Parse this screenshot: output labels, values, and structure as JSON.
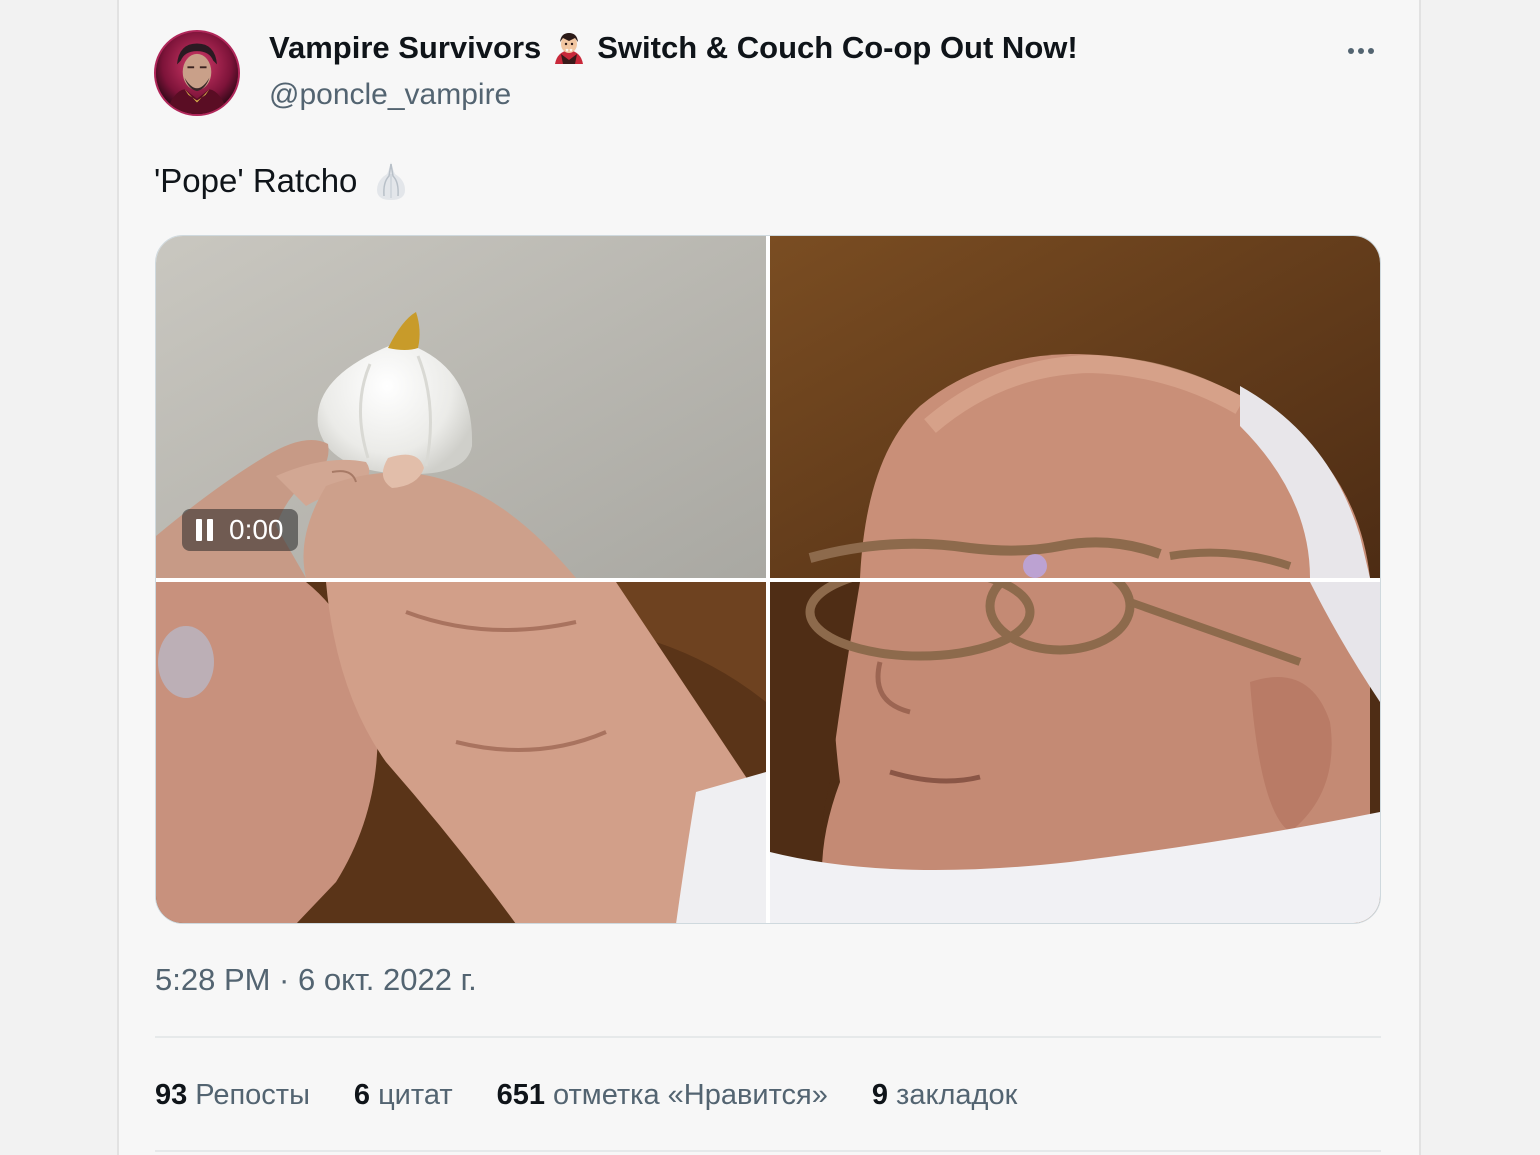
{
  "author": {
    "display_name_part1": "Vampire Survivors",
    "display_name_part2": "Switch & Couch Co-op Out Now!",
    "name_emoji": "vampire-emoji",
    "handle": "@poncle_vampire"
  },
  "tweet": {
    "text": "'Pope' Ratcho",
    "emoji": "garlic-emoji"
  },
  "media": {
    "video_time": "0:00",
    "video_control": "pause-icon"
  },
  "meta": {
    "timestamp": "5:28 PM · 6 окт. 2022 г."
  },
  "stats": [
    {
      "count": "93",
      "label": "Репосты"
    },
    {
      "count": "6",
      "label": "цитат"
    },
    {
      "count": "651",
      "label": "отметка «Нравится»"
    },
    {
      "count": "9",
      "label": "закладок"
    }
  ],
  "colors": {
    "text_primary": "#0f1419",
    "text_secondary": "#536471",
    "avatar_accent": "#b0275a",
    "background": "#f7f7f7"
  }
}
